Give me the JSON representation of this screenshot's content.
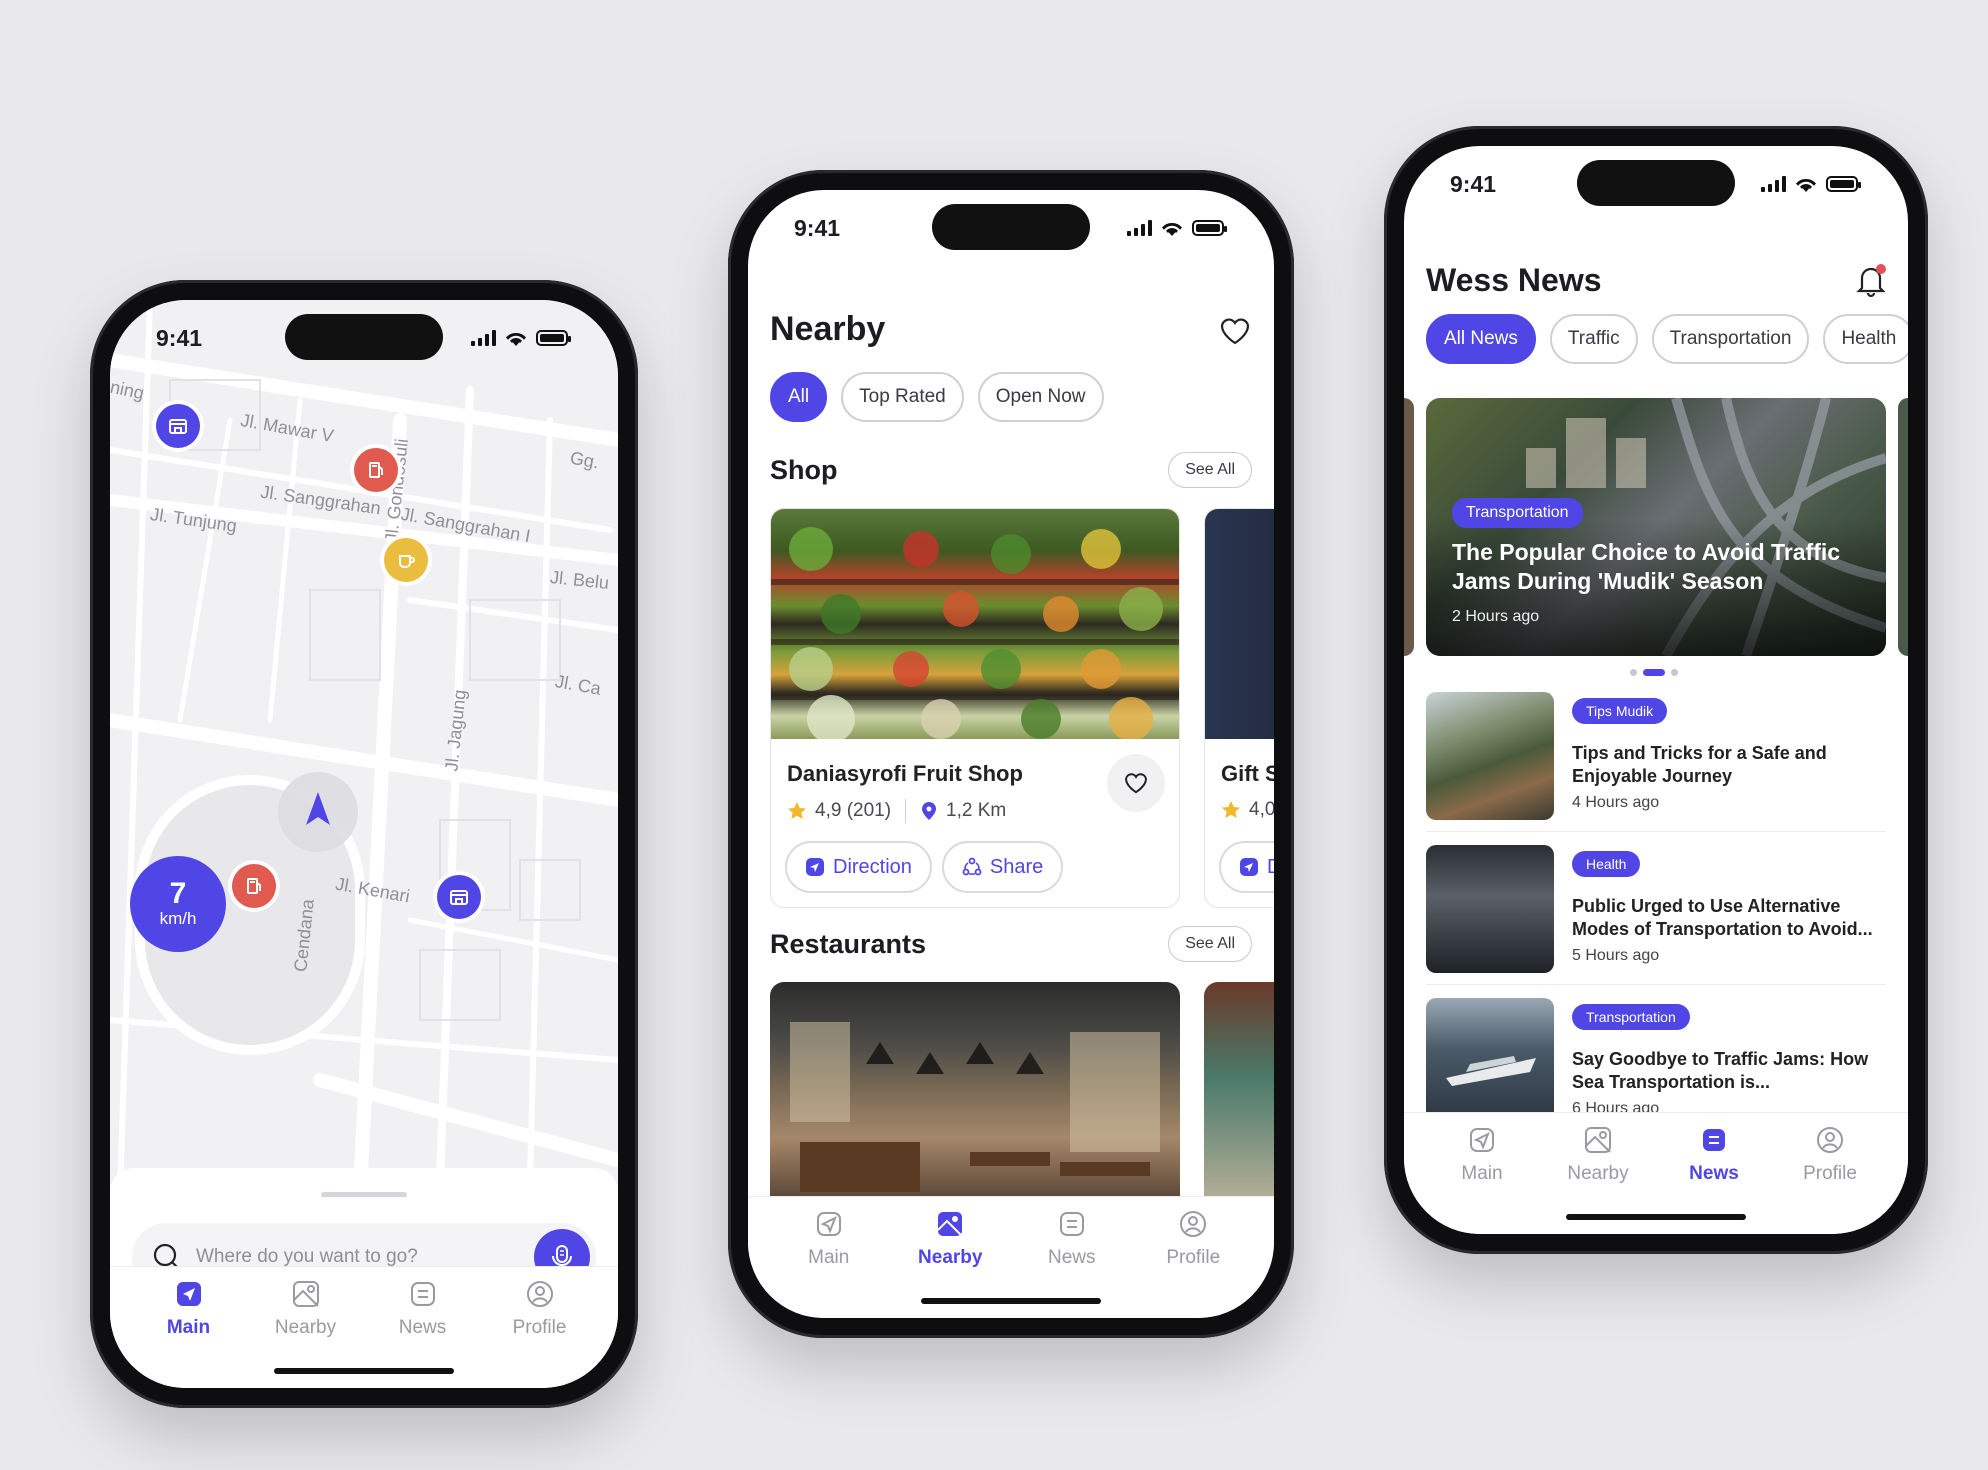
{
  "status": {
    "time": "9:41"
  },
  "tabs": [
    "Main",
    "Nearby",
    "News",
    "Profile"
  ],
  "map_screen": {
    "streets": [
      "Jl. Mawar V",
      "Jl. Sanggrahan",
      "Jl. Tunjung",
      "Jl. Sanggrahan I",
      "Jl. Gondosuli",
      "Jl. Belu",
      "Jl. Ca",
      "Jl. Jagung",
      "Jl. Kenari",
      "Cendana",
      "Gg.",
      "ning"
    ],
    "speed_value": "7",
    "speed_unit": "km/h",
    "search_placeholder": "Where do you want to go?",
    "colors": {
      "accent": "#5046e5",
      "fuel_pin": "#e05a50",
      "cafe_pin": "#eabd3e"
    }
  },
  "nearby_screen": {
    "title": "Nearby",
    "filters": [
      "All",
      "Top Rated",
      "Open Now"
    ],
    "shop_section": "Shop",
    "restaurants_section": "Restaurants",
    "see_all": "See All",
    "shop_card": {
      "name": "Daniasyrofi Fruit Shop",
      "rating": "4,9 (201)",
      "distance": "1,2 Km",
      "direction_label": "Direction",
      "share_label": "Share"
    },
    "peek_card": {
      "name": "Gift S",
      "rating": "4,0",
      "btn": "D"
    }
  },
  "news_screen": {
    "title": "Wess News",
    "filters": [
      "All News",
      "Traffic",
      "Transportation",
      "Health"
    ],
    "hero": {
      "tag": "Transportation",
      "title": "The Popular Choice to Avoid Traffic Jams During 'Mudik' Season",
      "time": "2 Hours ago"
    },
    "items": [
      {
        "tag": "Tips Mudik",
        "title": "Tips and Tricks for a Safe and Enjoyable Journey",
        "time": "4 Hours ago"
      },
      {
        "tag": "Health",
        "title": "Public Urged to Use Alternative Modes of Transportation to Avoid...",
        "time": "5 Hours ago"
      },
      {
        "tag": "Transportation",
        "title": "Say Goodbye to Traffic Jams: How Sea Transportation is...",
        "time": "6 Hours ago"
      }
    ]
  }
}
